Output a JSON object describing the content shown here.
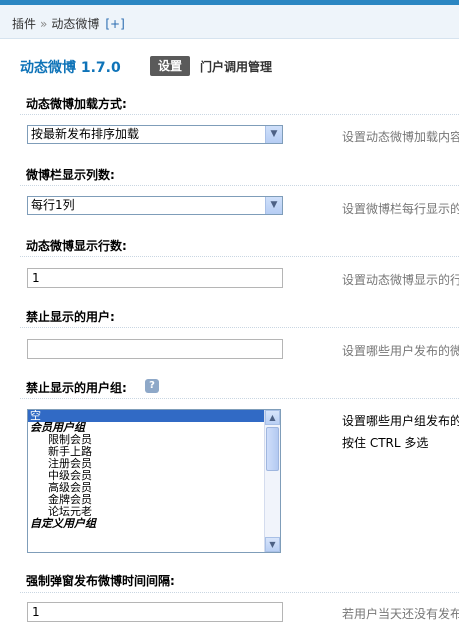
{
  "breadcrumb": {
    "root": "插件",
    "separator": "»",
    "current": "动态微博",
    "add": "[+]"
  },
  "header": {
    "title": "动态微博  1.7.0",
    "tab_active": "设置",
    "tab_other": "门户调用管理"
  },
  "fields": {
    "load_mode": {
      "label": "动态微博加载方式:",
      "value": "按最新发布排序加载",
      "hint": "设置动态微博加载内容"
    },
    "columns": {
      "label": "微博栏显示列数:",
      "value": "每行1列",
      "hint": "设置微博栏每行显示的"
    },
    "rows": {
      "label": "动态微博显示行数:",
      "value": "1",
      "hint": "设置动态微博显示的行"
    },
    "banned_users": {
      "label": "禁止显示的用户:",
      "value": "",
      "hint": "设置哪些用户发布的微"
    },
    "banned_groups": {
      "label": "禁止显示的用户组:",
      "help_icon": "help-icon",
      "hint_line1": "设置哪些用户组发布的",
      "hint_line2": "按住  CTRL  多选",
      "options": [
        {
          "text": "空",
          "type": "selected"
        },
        {
          "text": "会员用户组",
          "type": "group"
        },
        {
          "text": "限制会员",
          "type": "item"
        },
        {
          "text": "新手上路",
          "type": "item"
        },
        {
          "text": "注册会员",
          "type": "item"
        },
        {
          "text": "中级会员",
          "type": "item"
        },
        {
          "text": "高级会员",
          "type": "item"
        },
        {
          "text": "金牌会员",
          "type": "item"
        },
        {
          "text": "论坛元老",
          "type": "item"
        },
        {
          "text": "自定义用户组",
          "type": "group"
        }
      ]
    },
    "popup_interval": {
      "label": "强制弹窗发布微博时间间隔:",
      "value": "1",
      "hint": "若用户当天还没有发布"
    }
  },
  "colors": {
    "accent": "#0e73b8",
    "topbar": "#2b86c2",
    "selection": "#316ac5"
  }
}
